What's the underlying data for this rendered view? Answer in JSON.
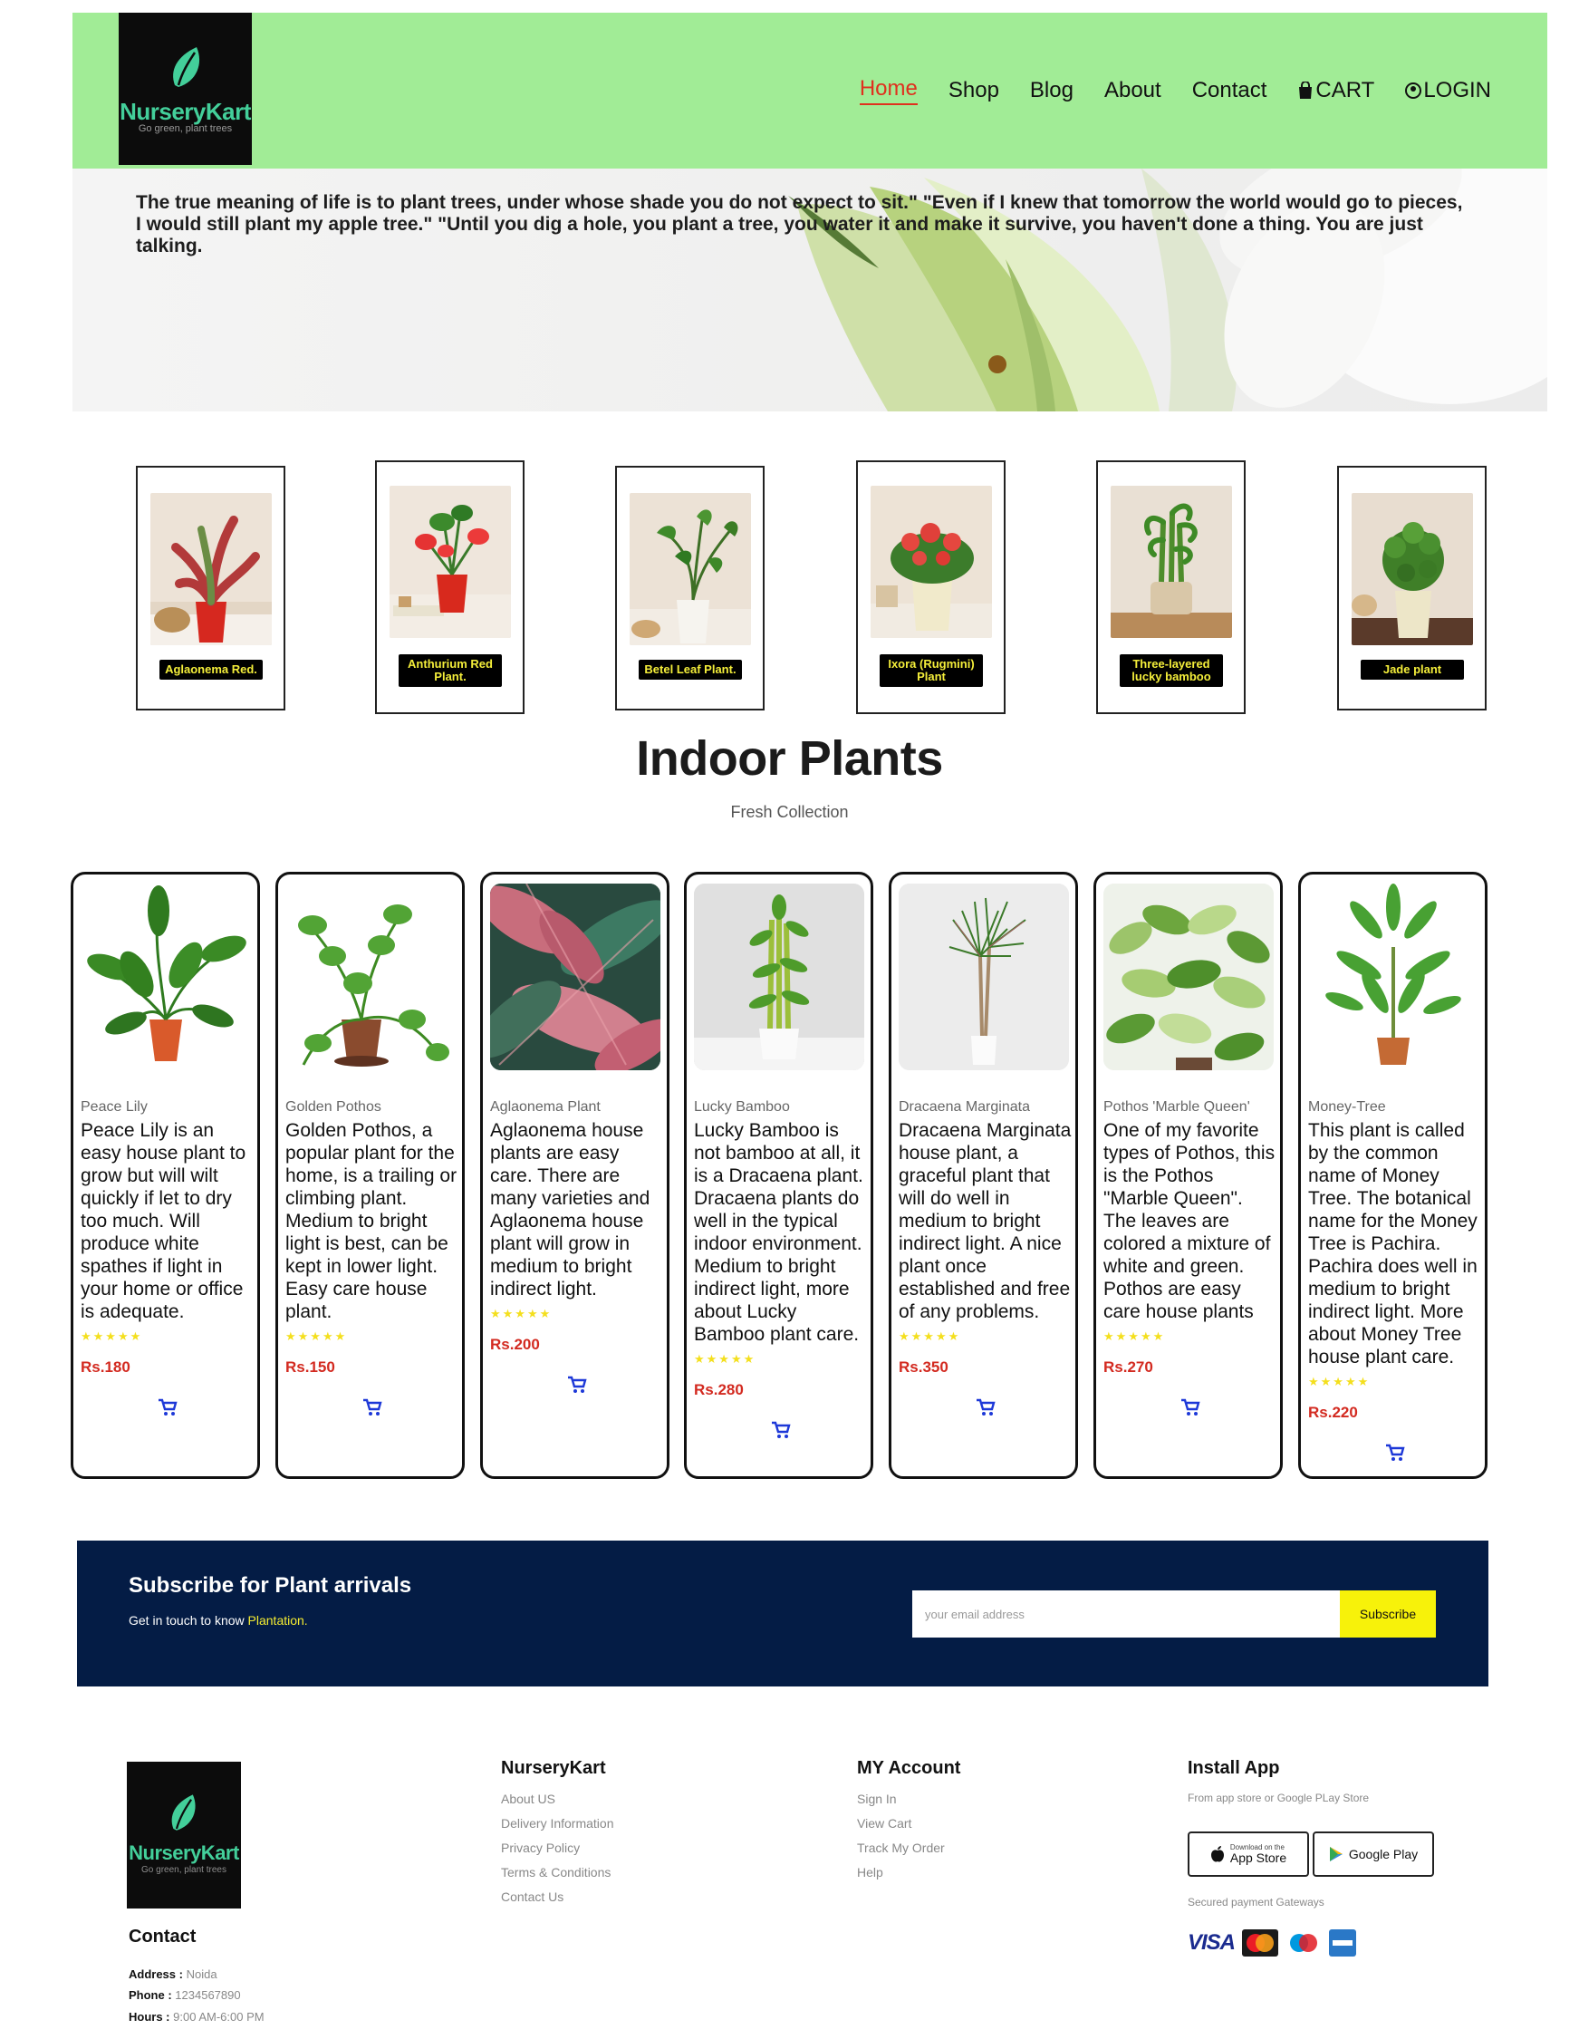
{
  "brand": {
    "name": "NurseryKart",
    "tagline": "Go green, plant trees"
  },
  "nav": {
    "home": "Home",
    "shop": "Shop",
    "blog": "Blog",
    "about": "About",
    "contact": "Contact",
    "cart": "CART",
    "login": "LOGIN"
  },
  "hero": {
    "quote": "The true meaning of life is to plant trees, under whose shade you do not expect to sit.\" \"Even if I knew that tomorrow the world would go to pieces, I would still plant my apple tree.\" \"Until you dig a hole, you plant a tree, you water it and make it survive, you haven't done a thing. You are just talking."
  },
  "featured": [
    {
      "label": "Aglaonema Red."
    },
    {
      "label": "Anthurium Red Plant."
    },
    {
      "label": "Betel Leaf Plant."
    },
    {
      "label": "Ixora (Rugmini) Plant"
    },
    {
      "label": "Three-layered lucky bamboo"
    },
    {
      "label": "Jade plant"
    }
  ],
  "section": {
    "title": "Indoor Plants",
    "subtitle": "Fresh Collection"
  },
  "products": [
    {
      "name": "Peace Lily",
      "desc": "Peace Lily is an easy house plant to grow but will wilt quickly if let to dry too much. Will produce white spathes if light in your home or office is adequate.",
      "rating": 5,
      "stars": "★★★★★",
      "price": "Rs.180"
    },
    {
      "name": "Golden Pothos",
      "desc": "Golden Pothos, a popular plant for the home, is a trailing or climbing plant. Medium to bright light is best, can be kept in lower light. Easy care house plant.",
      "rating": 5,
      "stars": "★★★★★",
      "price": "Rs.150"
    },
    {
      "name": "Aglaonema Plant",
      "desc": "Aglaonema house plants are easy care. There are many varieties and Aglaonema house plant will grow in medium to bright indirect light.",
      "rating": 5,
      "stars": "★★★★★",
      "price": "Rs.200"
    },
    {
      "name": "Lucky Bamboo",
      "desc": "Lucky Bamboo is not bamboo at all, it is a Dracaena plant. Dracaena plants do well in the typical indoor environment. Medium to bright indirect light, more about Lucky Bamboo plant care.",
      "rating": 5,
      "stars": "★★★★★",
      "price": "Rs.280"
    },
    {
      "name": "Dracaena Marginata",
      "desc": "Dracaena Marginata house plant, a graceful plant that will do well in medium to bright indirect light. A nice plant once established and free of any problems.",
      "rating": 5,
      "stars": "★★★★★",
      "price": "Rs.350"
    },
    {
      "name": "Pothos 'Marble Queen'",
      "desc": "One of my favorite types of Pothos, this is the Pothos \"Marble Queen\". The leaves are colored a mixture of white and green. Pothos are easy care house plants",
      "rating": 5,
      "stars": "★★★★★",
      "price": "Rs.270"
    },
    {
      "name": "Money-Tree",
      "desc": "This plant is called by the common name of Money Tree. The botanical name for the Money Tree is Pachira. Pachira does well in medium to bright indirect light. More about Money Tree house plant care.",
      "rating": 5,
      "stars": "★★★★★",
      "price": "Rs.220"
    }
  ],
  "newsletter": {
    "title": "Subscribe for Plant arrivals",
    "text": "Get in touch to know",
    "highlight": "Plantation.",
    "placeholder": "your email address",
    "button": "Subscribe"
  },
  "footer": {
    "contact": {
      "title": "Contact",
      "address_label": "Address :",
      "address": "Noida",
      "phone_label": "Phone :",
      "phone": "1234567890",
      "hours_label": "Hours :",
      "hours": "9:00 AM-6:00 PM"
    },
    "col1": {
      "title": "NurseryKart",
      "links": [
        "About US",
        "Delivery Information",
        "Privacy Policy",
        "Terms & Conditions",
        "Contact Us"
      ]
    },
    "col2": {
      "title": "MY Account",
      "links": [
        "Sign In",
        "View Cart",
        "Track My Order",
        "Help"
      ]
    },
    "install": {
      "title": "Install App",
      "text": "From app store or Google PLay Store",
      "appstore_small": "Download on the",
      "appstore": "App Store",
      "googleplay": "Google Play",
      "secured": "Secured payment Gateways",
      "visa": "VISA"
    }
  },
  "colors": {
    "header_bg": "#a1ec96",
    "nav_active": "#e0301e",
    "newsletter_bg": "#041c45",
    "accent_yellow": "#f7f20a",
    "price": "#d32a20"
  }
}
